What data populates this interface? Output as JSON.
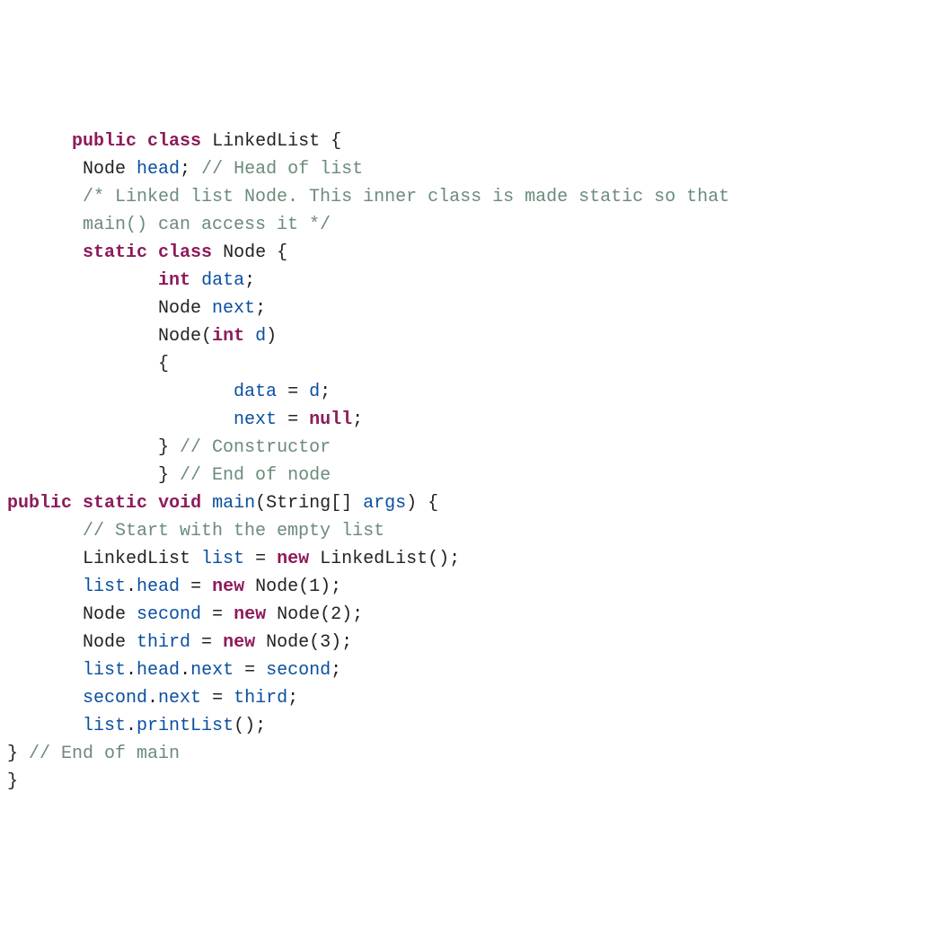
{
  "code": {
    "lines": [
      {
        "indent": "      ",
        "tokens": [
          {
            "t": "public",
            "c": "kw"
          },
          {
            "t": " ",
            "c": "pun"
          },
          {
            "t": "class",
            "c": "kw"
          },
          {
            "t": " ",
            "c": "pun"
          },
          {
            "t": "LinkedList",
            "c": "cls"
          },
          {
            "t": " {",
            "c": "pun"
          }
        ]
      },
      {
        "indent": "       ",
        "tokens": [
          {
            "t": "Node ",
            "c": "cls"
          },
          {
            "t": "head",
            "c": "id"
          },
          {
            "t": "; ",
            "c": "pun"
          },
          {
            "t": "// Head of list",
            "c": "cmt"
          }
        ]
      },
      {
        "indent": "       ",
        "tokens": [
          {
            "t": "/* Linked list Node. This inner class is made static so that",
            "c": "cmt"
          }
        ]
      },
      {
        "indent": "       ",
        "tokens": [
          {
            "t": "main() can access it */",
            "c": "cmt"
          }
        ]
      },
      {
        "indent": "",
        "tokens": [
          {
            "t": "",
            "c": "pun"
          }
        ]
      },
      {
        "indent": "       ",
        "tokens": [
          {
            "t": "static",
            "c": "kw"
          },
          {
            "t": " ",
            "c": "pun"
          },
          {
            "t": "class",
            "c": "kw"
          },
          {
            "t": " ",
            "c": "pun"
          },
          {
            "t": "Node",
            "c": "cls"
          },
          {
            "t": " {",
            "c": "pun"
          }
        ]
      },
      {
        "indent": "              ",
        "tokens": [
          {
            "t": "int",
            "c": "kw"
          },
          {
            "t": " ",
            "c": "pun"
          },
          {
            "t": "data",
            "c": "id"
          },
          {
            "t": ";",
            "c": "pun"
          }
        ]
      },
      {
        "indent": "              ",
        "tokens": [
          {
            "t": "Node ",
            "c": "cls"
          },
          {
            "t": "next",
            "c": "id"
          },
          {
            "t": ";",
            "c": "pun"
          }
        ]
      },
      {
        "indent": "              ",
        "tokens": [
          {
            "t": "Node",
            "c": "cls"
          },
          {
            "t": "(",
            "c": "pun"
          },
          {
            "t": "int",
            "c": "kw"
          },
          {
            "t": " ",
            "c": "pun"
          },
          {
            "t": "d",
            "c": "id"
          },
          {
            "t": ")",
            "c": "pun"
          }
        ]
      },
      {
        "indent": "              ",
        "tokens": [
          {
            "t": "{",
            "c": "pun"
          }
        ]
      },
      {
        "indent": "                     ",
        "tokens": [
          {
            "t": "data",
            "c": "id"
          },
          {
            "t": " = ",
            "c": "pun"
          },
          {
            "t": "d",
            "c": "id"
          },
          {
            "t": ";",
            "c": "pun"
          }
        ]
      },
      {
        "indent": "                     ",
        "tokens": [
          {
            "t": "next",
            "c": "id"
          },
          {
            "t": " = ",
            "c": "pun"
          },
          {
            "t": "null",
            "c": "kw"
          },
          {
            "t": ";",
            "c": "pun"
          }
        ]
      },
      {
        "indent": "              ",
        "tokens": [
          {
            "t": "} ",
            "c": "pun"
          },
          {
            "t": "// Constructor",
            "c": "cmt"
          }
        ]
      },
      {
        "indent": "",
        "tokens": [
          {
            "t": "",
            "c": "pun"
          }
        ]
      },
      {
        "indent": "              ",
        "tokens": [
          {
            "t": "} ",
            "c": "pun"
          },
          {
            "t": "// End of node",
            "c": "cmt"
          }
        ]
      },
      {
        "indent": "",
        "tokens": [
          {
            "t": "",
            "c": "pun"
          }
        ]
      },
      {
        "indent": "",
        "tokens": [
          {
            "t": "public",
            "c": "kw"
          },
          {
            "t": " ",
            "c": "pun"
          },
          {
            "t": "static",
            "c": "kw"
          },
          {
            "t": " ",
            "c": "pun"
          },
          {
            "t": "void",
            "c": "kw"
          },
          {
            "t": " ",
            "c": "pun"
          },
          {
            "t": "main",
            "c": "mth"
          },
          {
            "t": "(String[] ",
            "c": "cls"
          },
          {
            "t": "args",
            "c": "id"
          },
          {
            "t": ") {",
            "c": "pun"
          }
        ]
      },
      {
        "indent": "       ",
        "tokens": [
          {
            "t": "// Start with the empty list",
            "c": "cmt"
          }
        ]
      },
      {
        "indent": "       ",
        "tokens": [
          {
            "t": "LinkedList ",
            "c": "cls"
          },
          {
            "t": "list",
            "c": "id"
          },
          {
            "t": " = ",
            "c": "pun"
          },
          {
            "t": "new",
            "c": "kw"
          },
          {
            "t": " ",
            "c": "pun"
          },
          {
            "t": "LinkedList",
            "c": "cls"
          },
          {
            "t": "();",
            "c": "pun"
          }
        ]
      },
      {
        "indent": "       ",
        "tokens": [
          {
            "t": "list",
            "c": "id"
          },
          {
            "t": ".",
            "c": "pun"
          },
          {
            "t": "head",
            "c": "id"
          },
          {
            "t": " = ",
            "c": "pun"
          },
          {
            "t": "new",
            "c": "kw"
          },
          {
            "t": " ",
            "c": "pun"
          },
          {
            "t": "Node",
            "c": "cls"
          },
          {
            "t": "(",
            "c": "pun"
          },
          {
            "t": "1",
            "c": "num"
          },
          {
            "t": ");",
            "c": "pun"
          }
        ]
      },
      {
        "indent": "       ",
        "tokens": [
          {
            "t": "Node ",
            "c": "cls"
          },
          {
            "t": "second",
            "c": "id"
          },
          {
            "t": " = ",
            "c": "pun"
          },
          {
            "t": "new",
            "c": "kw"
          },
          {
            "t": " ",
            "c": "pun"
          },
          {
            "t": "Node",
            "c": "cls"
          },
          {
            "t": "(",
            "c": "pun"
          },
          {
            "t": "2",
            "c": "num"
          },
          {
            "t": ");",
            "c": "pun"
          }
        ]
      },
      {
        "indent": "       ",
        "tokens": [
          {
            "t": "Node ",
            "c": "cls"
          },
          {
            "t": "third",
            "c": "id"
          },
          {
            "t": " = ",
            "c": "pun"
          },
          {
            "t": "new",
            "c": "kw"
          },
          {
            "t": " ",
            "c": "pun"
          },
          {
            "t": "Node",
            "c": "cls"
          },
          {
            "t": "(",
            "c": "pun"
          },
          {
            "t": "3",
            "c": "num"
          },
          {
            "t": ");",
            "c": "pun"
          }
        ]
      },
      {
        "indent": "",
        "tokens": [
          {
            "t": "",
            "c": "pun"
          }
        ]
      },
      {
        "indent": "       ",
        "tokens": [
          {
            "t": "list",
            "c": "id"
          },
          {
            "t": ".",
            "c": "pun"
          },
          {
            "t": "head",
            "c": "id"
          },
          {
            "t": ".",
            "c": "pun"
          },
          {
            "t": "next",
            "c": "id"
          },
          {
            "t": " = ",
            "c": "pun"
          },
          {
            "t": "second",
            "c": "id"
          },
          {
            "t": ";",
            "c": "pun"
          }
        ]
      },
      {
        "indent": "       ",
        "tokens": [
          {
            "t": "second",
            "c": "id"
          },
          {
            "t": ".",
            "c": "pun"
          },
          {
            "t": "next",
            "c": "id"
          },
          {
            "t": " = ",
            "c": "pun"
          },
          {
            "t": "third",
            "c": "id"
          },
          {
            "t": ";",
            "c": "pun"
          }
        ]
      },
      {
        "indent": "",
        "tokens": [
          {
            "t": "",
            "c": "pun"
          }
        ]
      },
      {
        "indent": "       ",
        "tokens": [
          {
            "t": "list",
            "c": "id"
          },
          {
            "t": ".",
            "c": "pun"
          },
          {
            "t": "printList",
            "c": "mth"
          },
          {
            "t": "();",
            "c": "pun"
          }
        ]
      },
      {
        "indent": "",
        "tokens": [
          {
            "t": "} ",
            "c": "pun"
          },
          {
            "t": "// End of main",
            "c": "cmt"
          }
        ]
      },
      {
        "indent": "",
        "tokens": [
          {
            "t": "}",
            "c": "pun"
          }
        ]
      }
    ]
  }
}
